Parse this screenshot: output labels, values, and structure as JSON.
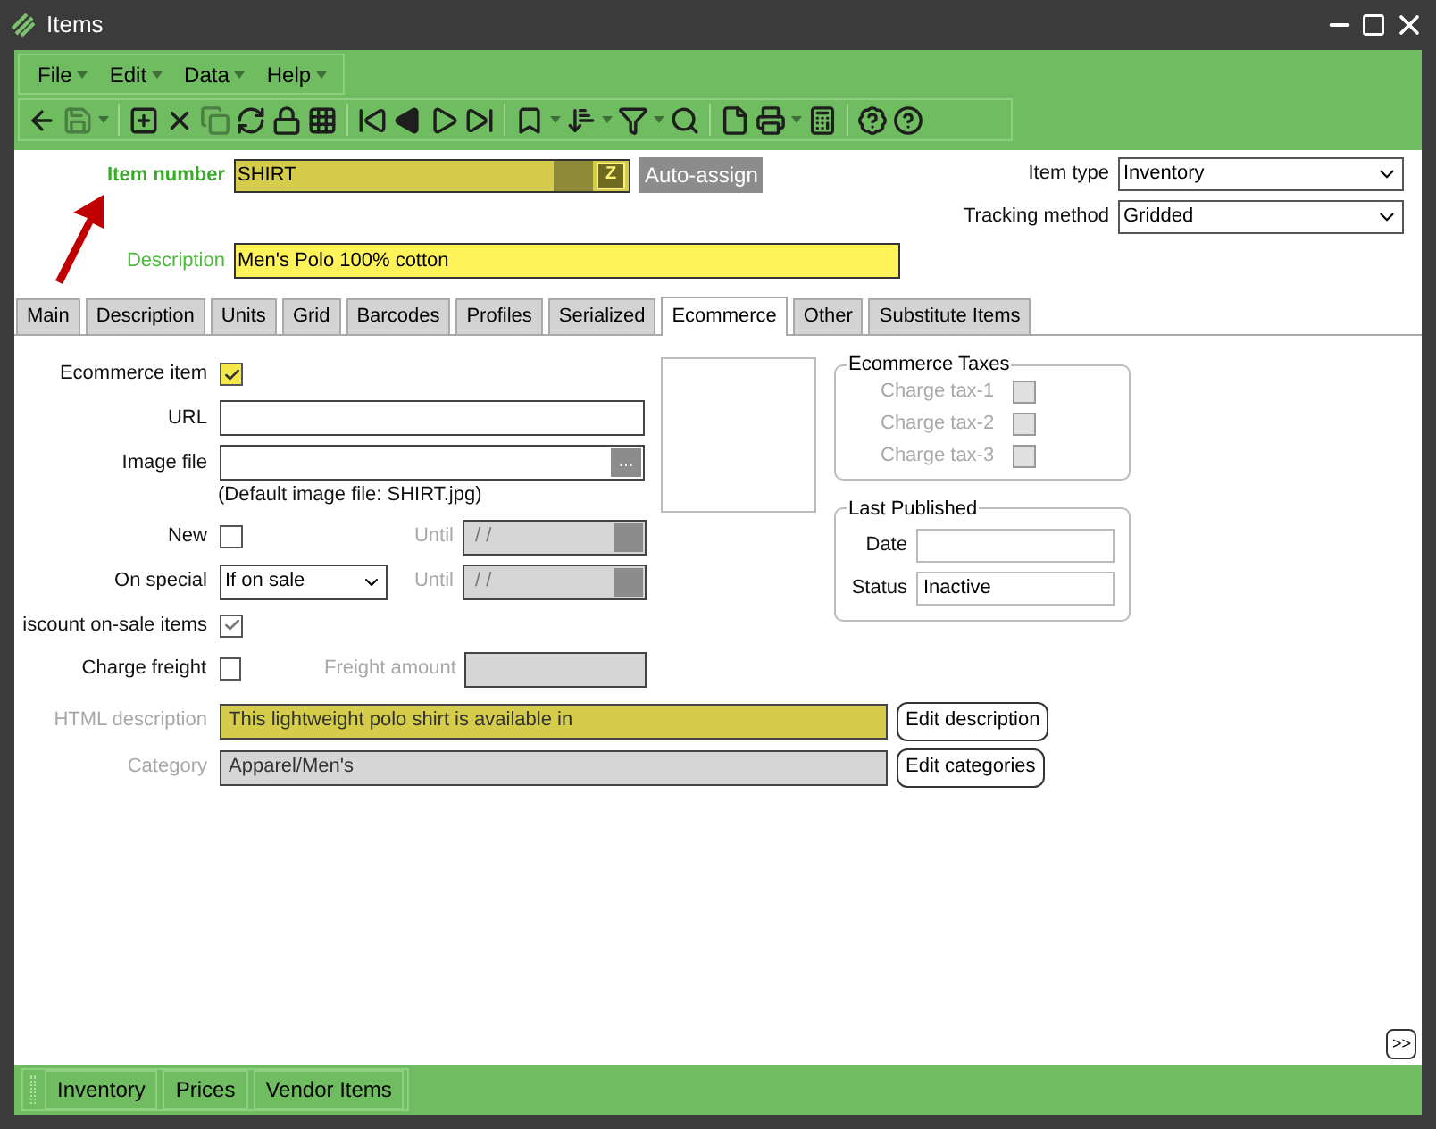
{
  "window": {
    "title": "Items"
  },
  "menu": [
    {
      "label": "File"
    },
    {
      "label": "Edit"
    },
    {
      "label": "Data"
    },
    {
      "label": "Help"
    }
  ],
  "header": {
    "item_number": {
      "label": "Item number",
      "value": "SHIRT",
      "z_button": "Z",
      "button": "Auto-assign"
    },
    "item_type": {
      "label": "Item type",
      "value": "Inventory"
    },
    "tracking_method": {
      "label": "Tracking method",
      "value": "Gridded"
    },
    "description": {
      "label": "Description",
      "value": "Men's Polo 100% cotton"
    }
  },
  "tabs": [
    {
      "label": "Main",
      "selected": false
    },
    {
      "label": "Description",
      "selected": false
    },
    {
      "label": "Units",
      "selected": false
    },
    {
      "label": "Grid",
      "selected": false
    },
    {
      "label": "Barcodes",
      "selected": false
    },
    {
      "label": "Profiles",
      "selected": false
    },
    {
      "label": "Serialized",
      "selected": false
    },
    {
      "label": "Ecommerce",
      "selected": true
    },
    {
      "label": "Other",
      "selected": false
    },
    {
      "label": "Substitute Items",
      "selected": false
    }
  ],
  "ecommerce": {
    "ecommerce_item": {
      "label": "Ecommerce item",
      "checked": true
    },
    "url": {
      "label": "URL"
    },
    "image_file": {
      "label": "Image file",
      "browse_button": "...",
      "note": "(Default image file: SHIRT.jpg)"
    },
    "new": {
      "label": "New",
      "checked": false,
      "until_label": "Until",
      "until_value": "/ /",
      "until_disabled": true
    },
    "on_special": {
      "label": "On special",
      "value": "If on sale",
      "until_label": "Until",
      "until_value": "/ /",
      "until_disabled": true
    },
    "discount": {
      "label": "iscount on-sale items",
      "checked": true
    },
    "charge_freight": {
      "label": "Charge freight",
      "checked": false,
      "amount_label": "Freight amount",
      "amount_disabled": true
    },
    "html_description": {
      "label": "HTML description",
      "value": "This lightweight polo shirt is available in",
      "button": "Edit description",
      "disabled": true
    },
    "category": {
      "label": "Category",
      "value": "Apparel/Men's",
      "button": "Edit categories",
      "disabled": true
    }
  },
  "taxes": {
    "title": "Ecommerce Taxes",
    "items": [
      {
        "label": "Charge tax-1",
        "checked": false,
        "disabled": true
      },
      {
        "label": "Charge tax-2",
        "checked": false,
        "disabled": true
      },
      {
        "label": "Charge tax-3",
        "checked": false,
        "disabled": true
      }
    ]
  },
  "last_published": {
    "title": "Last Published",
    "date_label": "Date",
    "status_label": "Status",
    "status_value": "Inactive"
  },
  "expand_button": ">>",
  "bottom_tabs": [
    {
      "label": "Inventory"
    },
    {
      "label": "Prices"
    },
    {
      "label": "Vendor Items"
    }
  ]
}
